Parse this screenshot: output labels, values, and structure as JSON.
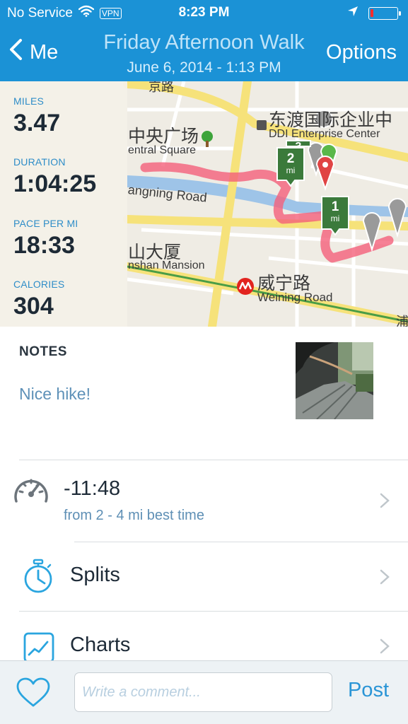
{
  "status_bar": {
    "carrier": "No Service",
    "vpn": "VPN",
    "time": "8:23 PM",
    "battery_level": 0.1
  },
  "nav": {
    "back_label": "Me",
    "title": "Friday Afternoon Walk",
    "subtitle": "June 6, 2014 - 1:13 PM",
    "options_label": "Options"
  },
  "stats": [
    {
      "label": "MILES",
      "value": "3.47"
    },
    {
      "label": "DURATION",
      "value": "1:04:25"
    },
    {
      "label": "PACE PER MI",
      "value": "18:33"
    },
    {
      "label": "CALORIES",
      "value": "304"
    }
  ],
  "map": {
    "labels": {
      "central_square_cn": "中央广场",
      "central_square_en": "entral Square",
      "ddi_cn": "东渡国际企业中",
      "ddi_en": "DDI Enterprise Center",
      "road_cn": "京路",
      "road_en": "angning Road",
      "mansion_cn": "山大厦",
      "mansion_en": "nshan Mansion",
      "weining_cn": "威宁路",
      "weining_en": "Weining Road",
      "edge_char": "浦"
    },
    "markers": [
      {
        "number": "2",
        "unit": "mi"
      },
      {
        "number": "1",
        "unit": "mi"
      },
      {
        "number": "3",
        "unit": "mi"
      }
    ],
    "colors": {
      "route": "#f4607a",
      "road": "#f6e27a",
      "river": "#9ec4e8",
      "milestone": "#3b7a3b"
    }
  },
  "notes": {
    "heading": "NOTES",
    "text": "Nice hike!"
  },
  "rows": {
    "best_time": {
      "title": "-11:48",
      "subtitle": "from 2 - 4 mi best time"
    },
    "splits": {
      "title": "Splits"
    },
    "charts": {
      "title": "Charts"
    }
  },
  "comment": {
    "placeholder": "Write a comment...",
    "post_label": "Post"
  },
  "colors": {
    "accent": "#1b92d6",
    "icon_blue": "#2aa5df",
    "text_dark": "#1e2b38"
  }
}
